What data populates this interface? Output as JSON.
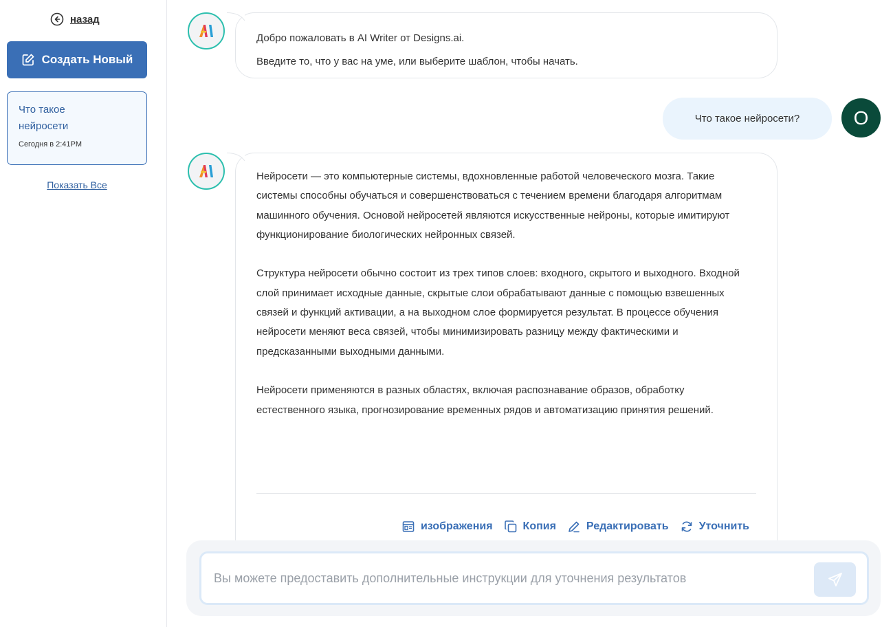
{
  "sidebar": {
    "back_label": "назад",
    "create_button_label": "Создать Новый",
    "history": [
      {
        "title": "Что такое нейросети",
        "time": "Сегодня в 2:41PM"
      }
    ],
    "show_all_label": "Показать Все"
  },
  "chat": {
    "welcome": {
      "line1": "Добро пожаловать в AI Writer от Designs.ai.",
      "line2": "Введите то, что у вас на уме, или выберите шаблон, чтобы начать."
    },
    "user_message": "Что такое нейросети?",
    "user_avatar_letter": "O",
    "answer": {
      "paragraphs": [
        "Нейросети — это компьютерные системы, вдохновленные работой человеческого мозга. Такие системы способны обучаться и совершенствоваться с течением времени благодаря алгоритмам машинного обучения. Основой нейросетей являются искусственные нейроны, которые имитируют функционирование биологических нейронных связей.",
        "Структура нейросети обычно состоит из трех типов слоев: входного, скрытого и выходного. Входной слой принимает исходные данные, скрытые слои обрабатывают данные с помощью взвешенных связей и функций активации, а на выходном слое формируется результат. В процессе обучения нейросети меняют веса связей, чтобы минимизировать разницу между фактическими и предсказанными выходными данными.",
        "Нейросети применяются в разных областях, включая распознавание образов, обработку естественного языка, прогнозирование временных рядов и автоматизацию принятия решений."
      ],
      "actions": {
        "images": "изображения",
        "copy": "Копия",
        "edit": "Редактировать",
        "refine": "Уточнить"
      }
    }
  },
  "composer": {
    "placeholder": "Вы можете предоставить дополнительные инструкции для уточнения результатов",
    "value": ""
  },
  "colors": {
    "accent": "#3a6fb6",
    "teal": "#2cbfae",
    "user_bubble": "#eaf4fd",
    "user_avatar": "#0a4a3a"
  },
  "icons": {
    "back": "circle-arrow-left-icon",
    "create": "edit-square-icon",
    "ai_logo": "designs-ai-logo",
    "images": "image-icon",
    "copy": "copy-icon",
    "edit": "pencil-icon",
    "refine": "refresh-icon",
    "send": "send-icon"
  }
}
